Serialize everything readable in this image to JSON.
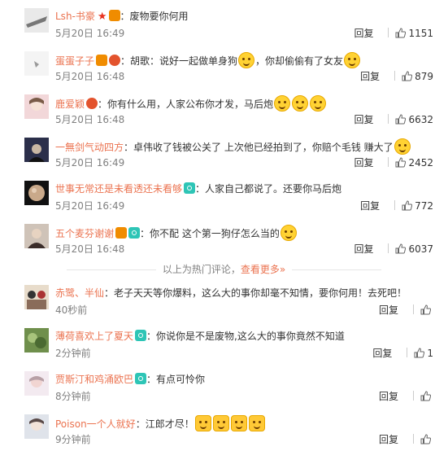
{
  "colors": {
    "username": "#eb7350",
    "time": "#808080",
    "text": "#333333"
  },
  "hot_comments": [
    {
      "username": "Lsh-书豪",
      "text": "废物要你何用",
      "time": "5月20日 16:49",
      "reply": "回复",
      "likes": "1151"
    },
    {
      "username": "蛋蛋子子",
      "text": "胡歌：说好一起做单身狗",
      "text2": "，你却偷偷有了女友",
      "time": "5月20日 16:48",
      "reply": "回复",
      "likes": "879"
    },
    {
      "username": "鹿爱颖",
      "text": "你有什么用，人家公布你才发，马后炮",
      "time": "5月20日 16:48",
      "reply": "回复",
      "likes": "6632"
    },
    {
      "username": "一無剑气动四方",
      "text": "卓伟收了钱被公关了 上次他已经拍到了，你赔个毛钱 赚大了",
      "time": "5月20日 16:49",
      "reply": "回复",
      "likes": "2452"
    },
    {
      "username": "世事无常还是未看透还未看够",
      "text": "人家自己都说了。还要你马后炮",
      "time": "5月20日 16:49",
      "reply": "回复",
      "likes": "772"
    },
    {
      "username": "五个麦芬谢谢",
      "text": "你不配 这个第一狗仔怎么当的",
      "time": "5月20日 16:48",
      "reply": "回复",
      "likes": "6037"
    }
  ],
  "more": {
    "prefix": "以上为热门评论，",
    "link": "查看更多»"
  },
  "new_comments": [
    {
      "username": "赤鹭、半仙",
      "text": "老子天天等你爆料，这么大的事你却毫不知情，要你何用！去死吧！",
      "time": "40秒前",
      "reply": "回复",
      "likes": ""
    },
    {
      "username": "薄荷喜欢上了夏天",
      "text": "你说你是不是废物,这么大的事你竟然不知道",
      "time": "2分钟前",
      "reply": "回复",
      "likes": "1"
    },
    {
      "username": "贾斯汀和鸡涌欧巴",
      "text": "有点可怜你",
      "time": "8分钟前",
      "reply": "回复",
      "likes": ""
    },
    {
      "username": "Poison一个人就好",
      "text": "江郎才尽！",
      "time": "9分钟前",
      "reply": "回复",
      "likes": ""
    }
  ]
}
